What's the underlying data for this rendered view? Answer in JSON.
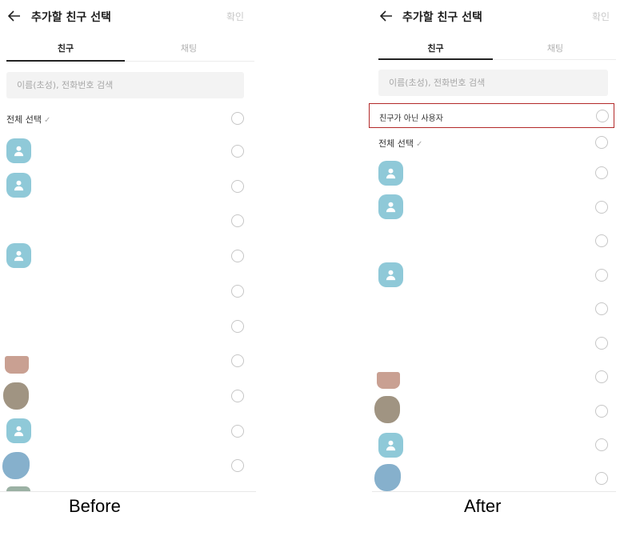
{
  "before": {
    "header": {
      "title": "추가할 친구 선택",
      "confirm_label": "확인"
    },
    "tabs": [
      {
        "label": "친구",
        "active": true
      },
      {
        "label": "채팅",
        "active": false
      }
    ],
    "search": {
      "placeholder": "이름(초성), 전화번호 검색"
    },
    "select_all": {
      "label": "전체 선택",
      "check_icon": "check-icon"
    }
  },
  "after": {
    "header": {
      "title": "추가할 친구 선택",
      "confirm_label": "확인"
    },
    "tabs": [
      {
        "label": "친구",
        "active": true
      },
      {
        "label": "채팅",
        "active": false
      }
    ],
    "search": {
      "placeholder": "이름(초성), 전화번호 검색"
    },
    "non_friend_user": {
      "label": "친구가 아닌 사용자"
    },
    "select_all": {
      "label": "전체 선택",
      "check_icon": "check-icon"
    }
  },
  "captions": {
    "before": "Before",
    "after": "After"
  },
  "colors": {
    "avatar_default": "#8fc9d8",
    "highlight_border": "#b32a2a",
    "confirm_disabled": "#c8c8c8"
  }
}
